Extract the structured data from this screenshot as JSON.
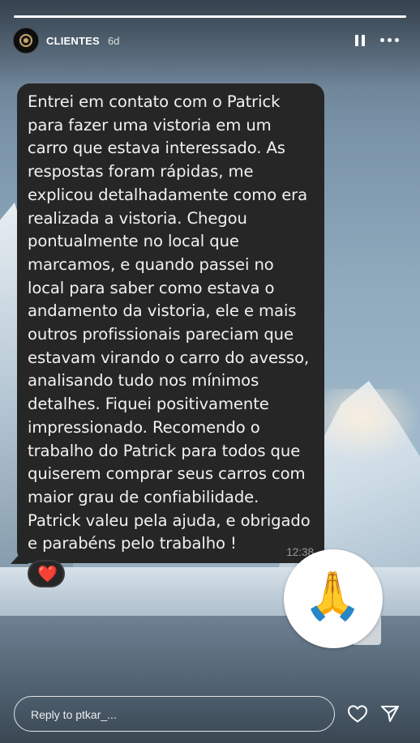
{
  "story": {
    "progress": 1.0
  },
  "header": {
    "username": "CLIENTES",
    "time": "6d",
    "pause_icon": "pause-icon",
    "more_icon": "more-dots-icon"
  },
  "message": {
    "text": "Entrei em contato com o Patrick\npara fazer uma vistoria em um\ncarro que estava interessado. As\nrespostas foram rápidas, me\nexplicou detalhadamente como era\nrealizada a vistoria. Chegou\npontualmente no local que\nmarcamos, e quando passei no\nlocal para saber como estava o\nandamento da vistoria, ele e mais\noutros profissionais pareciam que\nestavam virando o carro do avesso,\nanalisando tudo nos mínimos\ndetalhes. Fiquei positivamente\nimpressionado. Recomendo o\ntrabalho do Patrick para todos que\nquiserem comprar seus carros com\nmaior grau de confiabilidade.\nPatrick valeu pela ajuda, e obrigado\ne parabéns pelo trabalho !",
    "time": "12:38",
    "reaction": "❤️"
  },
  "sticker": {
    "emoji": "🙏"
  },
  "reply": {
    "placeholder": "Reply to ptkar_..."
  },
  "icons": {
    "like": "heart-icon",
    "share": "send-icon"
  },
  "colors": {
    "bubble": "#262626",
    "heart": "#e8253a"
  }
}
